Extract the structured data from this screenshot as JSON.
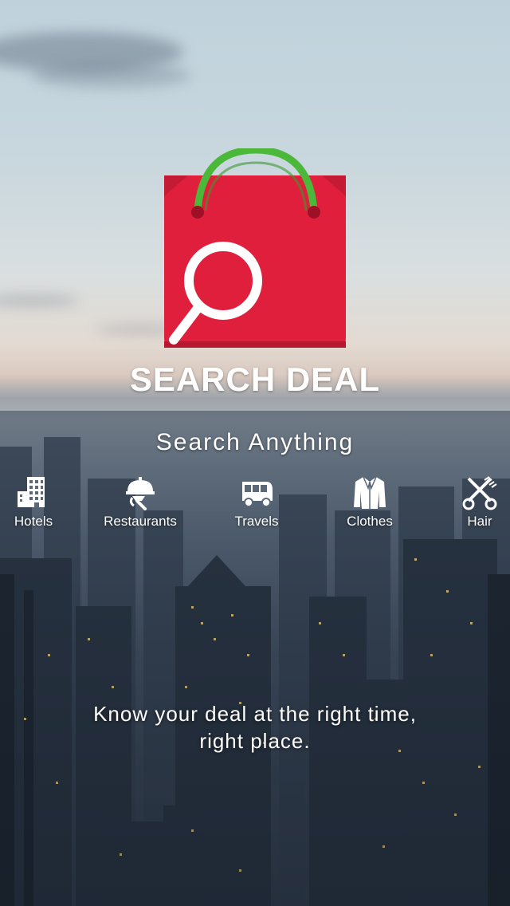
{
  "brand": {
    "title": "SEARCH DEAL"
  },
  "tagline": "Search Anything",
  "categories": [
    {
      "label": "Hotels",
      "icon": "hotel-icon"
    },
    {
      "label": "Restaurants",
      "icon": "restaurant-icon"
    },
    {
      "label": "Travels",
      "icon": "bus-icon"
    },
    {
      "label": "Clothes",
      "icon": "jacket-icon"
    },
    {
      "label": "Hair",
      "icon": "scissors-comb-icon"
    }
  ],
  "footer": {
    "line1": "Know your deal at the right time,",
    "line2": "right place."
  },
  "colors": {
    "bag_red": "#e01f3d",
    "handle_green": "#4cb83a",
    "text": "#ffffff"
  }
}
